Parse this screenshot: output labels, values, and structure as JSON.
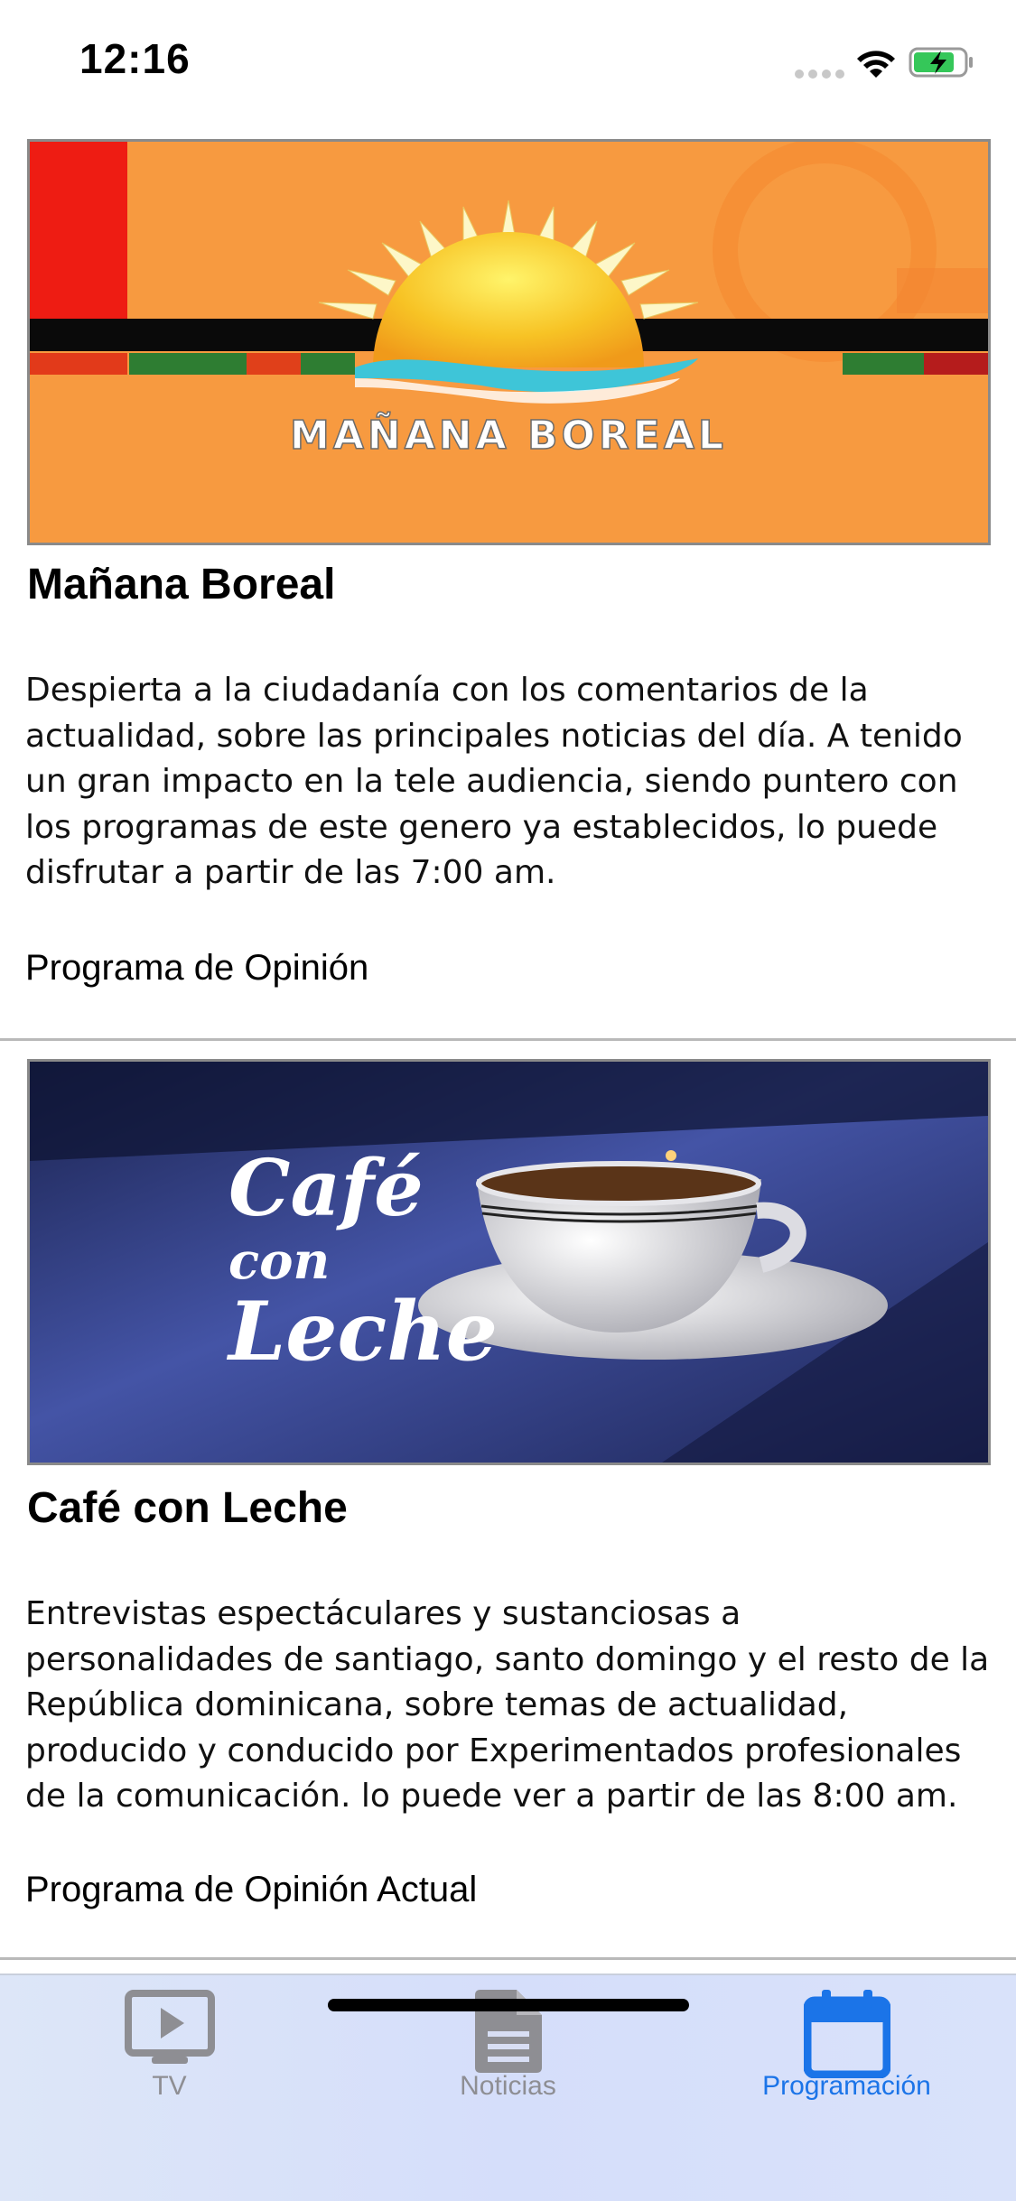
{
  "status_bar": {
    "time": "12:16"
  },
  "programs": [
    {
      "banner_text": "MAÑANA BOREAL",
      "title": "Mañana Boreal",
      "description": "Despierta a la ciudadanía con los comentarios de la actualidad, sobre las principales noticias del día. A tenido un gran impacto en la tele audiencia, siendo puntero con los programas de este genero ya establecidos, lo puede disfrutar a partir de las 7:00 am.",
      "category": "Programa de Opinión"
    },
    {
      "banner_text_1": "Café",
      "banner_text_2": "con",
      "banner_text_3": "Leche",
      "title": "Café con Leche",
      "description": "Entrevistas espectáculares y sustanciosas a personalidades de santiago, santo domingo y el resto de la República dominicana, sobre temas de actualidad, producido y conducido por Experimentados profesionales de la comunicación. lo puede ver a partir de las 8:00 am.",
      "category": "Programa de Opinión Actual"
    }
  ],
  "tab_bar": {
    "tabs": [
      {
        "label": "TV",
        "icon": "tv-play-icon"
      },
      {
        "label": "Noticias",
        "icon": "document-icon"
      },
      {
        "label": "Programación",
        "icon": "calendar-icon"
      }
    ],
    "active_index": 2,
    "active_color": "#1b74e8",
    "inactive_color": "#8e8e93"
  }
}
